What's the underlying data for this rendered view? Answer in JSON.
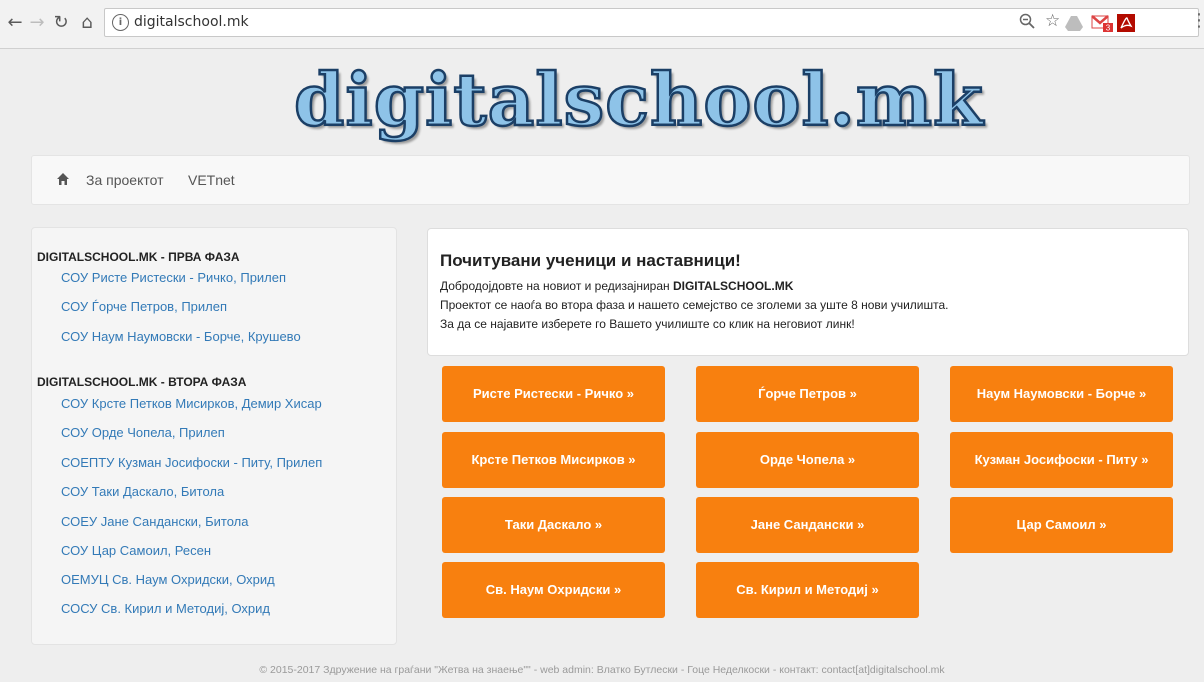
{
  "browser": {
    "url": "digitalschool.mk",
    "gmail_badge": "3"
  },
  "logo": {
    "text": "digitalschool.mk"
  },
  "navbar": {
    "items": [
      "За проектот",
      "VETnet"
    ]
  },
  "sidebar": {
    "phases": [
      {
        "title": "DIGITALSCHOOL.MK - ПРВА ФАЗА",
        "schools": [
          "СОУ Ристе Ристески - Ричко, Прилеп",
          "СОУ Ѓорче Петров, Прилеп",
          "СОУ Наум Наумовски - Борче, Крушево"
        ]
      },
      {
        "title": "DIGITALSCHOOL.MK - ВТОРА ФАЗА",
        "schools": [
          "СОУ Крсте Петков Мисирков, Демир Хисар",
          "СОУ Орде Чопела, Прилеп",
          "СОЕПТУ Кузман Јосифоски - Питу, Прилеп",
          "СОУ Таки Даскало, Битола",
          "СОЕУ Јане Сандански, Битола",
          "СОУ Цар Самоил, Ресен",
          "ОЕМУЦ Св. Наум Охридски, Охрид",
          "СОСУ Св. Кирил и Методиј, Охрид"
        ]
      }
    ]
  },
  "welcome": {
    "heading": "Почитувани ученици и наставници!",
    "line1_prefix": "Добродојдовте на новиот и редизајниран ",
    "line1_brand": "DIGITALSCHOOL.MK",
    "line2": "Проектот се наоѓа во втора фаза и нашето семејство се зголеми за уште 8 нови училишта.",
    "line3": "За да се најавите изберете го Вашето училиште со клик на неговиот линк!"
  },
  "buttons": [
    "Ристе Ристески - Ричко »",
    "Ѓорче Петров »",
    "Наум Наумовски - Борче »",
    "Крсте Петков Мисирков »",
    "Орде Чопела »",
    "Кузман Јосифоски - Питу »",
    "Таки Даскало »",
    "Јане Сандански »",
    "Цар Самоил »",
    "Св. Наум Охридски »",
    "Св. Кирил и Методиј »"
  ],
  "footer": {
    "text": "© 2015-2017 Здружение на граѓани \"Жетва на знаење\"\" - web admin: Влатко Бутлески - Гоце Неделкоски - контакт: contact[at]digitalschool.mk"
  },
  "colors": {
    "button": "#f8800f",
    "link": "#337ab7",
    "logo_fill": "#8ec3e8",
    "logo_stroke": "#1b3f66"
  }
}
